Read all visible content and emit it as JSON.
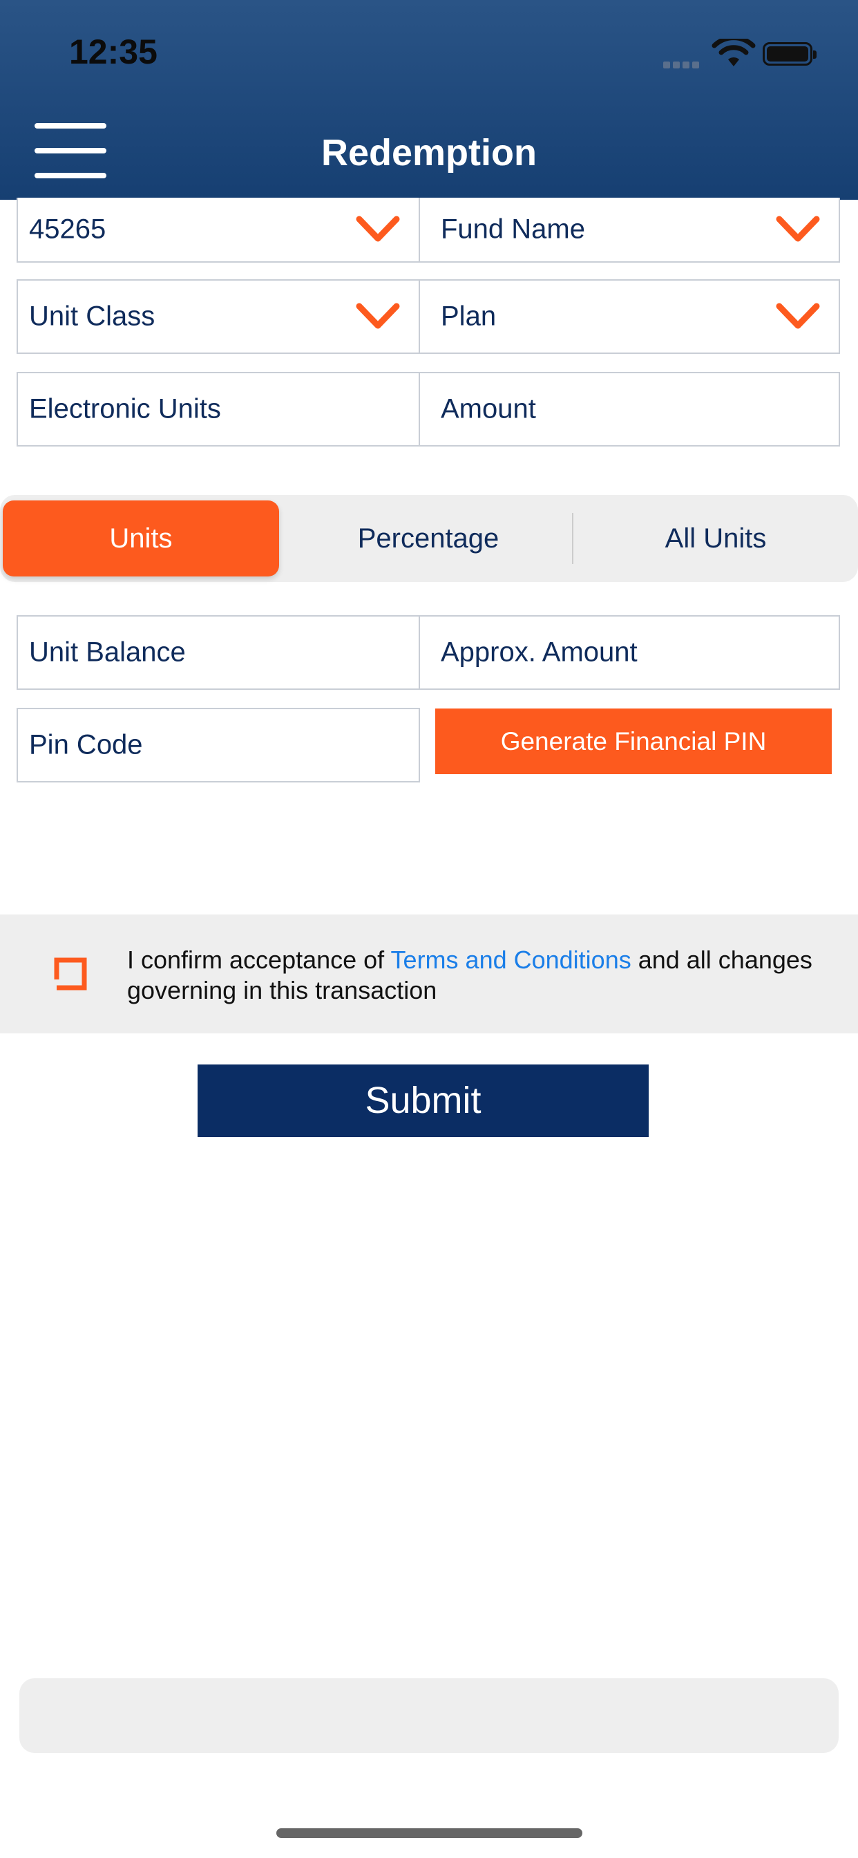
{
  "status_bar": {
    "time": "12:35"
  },
  "header": {
    "title": "Redemption"
  },
  "fields": {
    "folio": "45265",
    "fund_name": "Fund Name",
    "unit_class": "Unit Class",
    "plan": "Plan",
    "electronic_units": "Electronic Units",
    "amount": "Amount",
    "unit_balance": "Unit Balance",
    "approx_amount": "Approx. Amount",
    "pin_code": "Pin Code"
  },
  "segment": {
    "items": [
      "Units",
      "Percentage",
      "All Units"
    ],
    "selected": "Units"
  },
  "buttons": {
    "generate_pin": "Generate Financial PIN",
    "submit": "Submit"
  },
  "terms": {
    "prefix": "I confirm acceptance of ",
    "link": "Terms and Conditions",
    "suffix": " and all changes governing in this transaction",
    "checked": false
  },
  "colors": {
    "header": "#1f4a7c",
    "accent": "#fd5a1e",
    "submit": "#0b2d64",
    "link": "#1a7ee8"
  }
}
